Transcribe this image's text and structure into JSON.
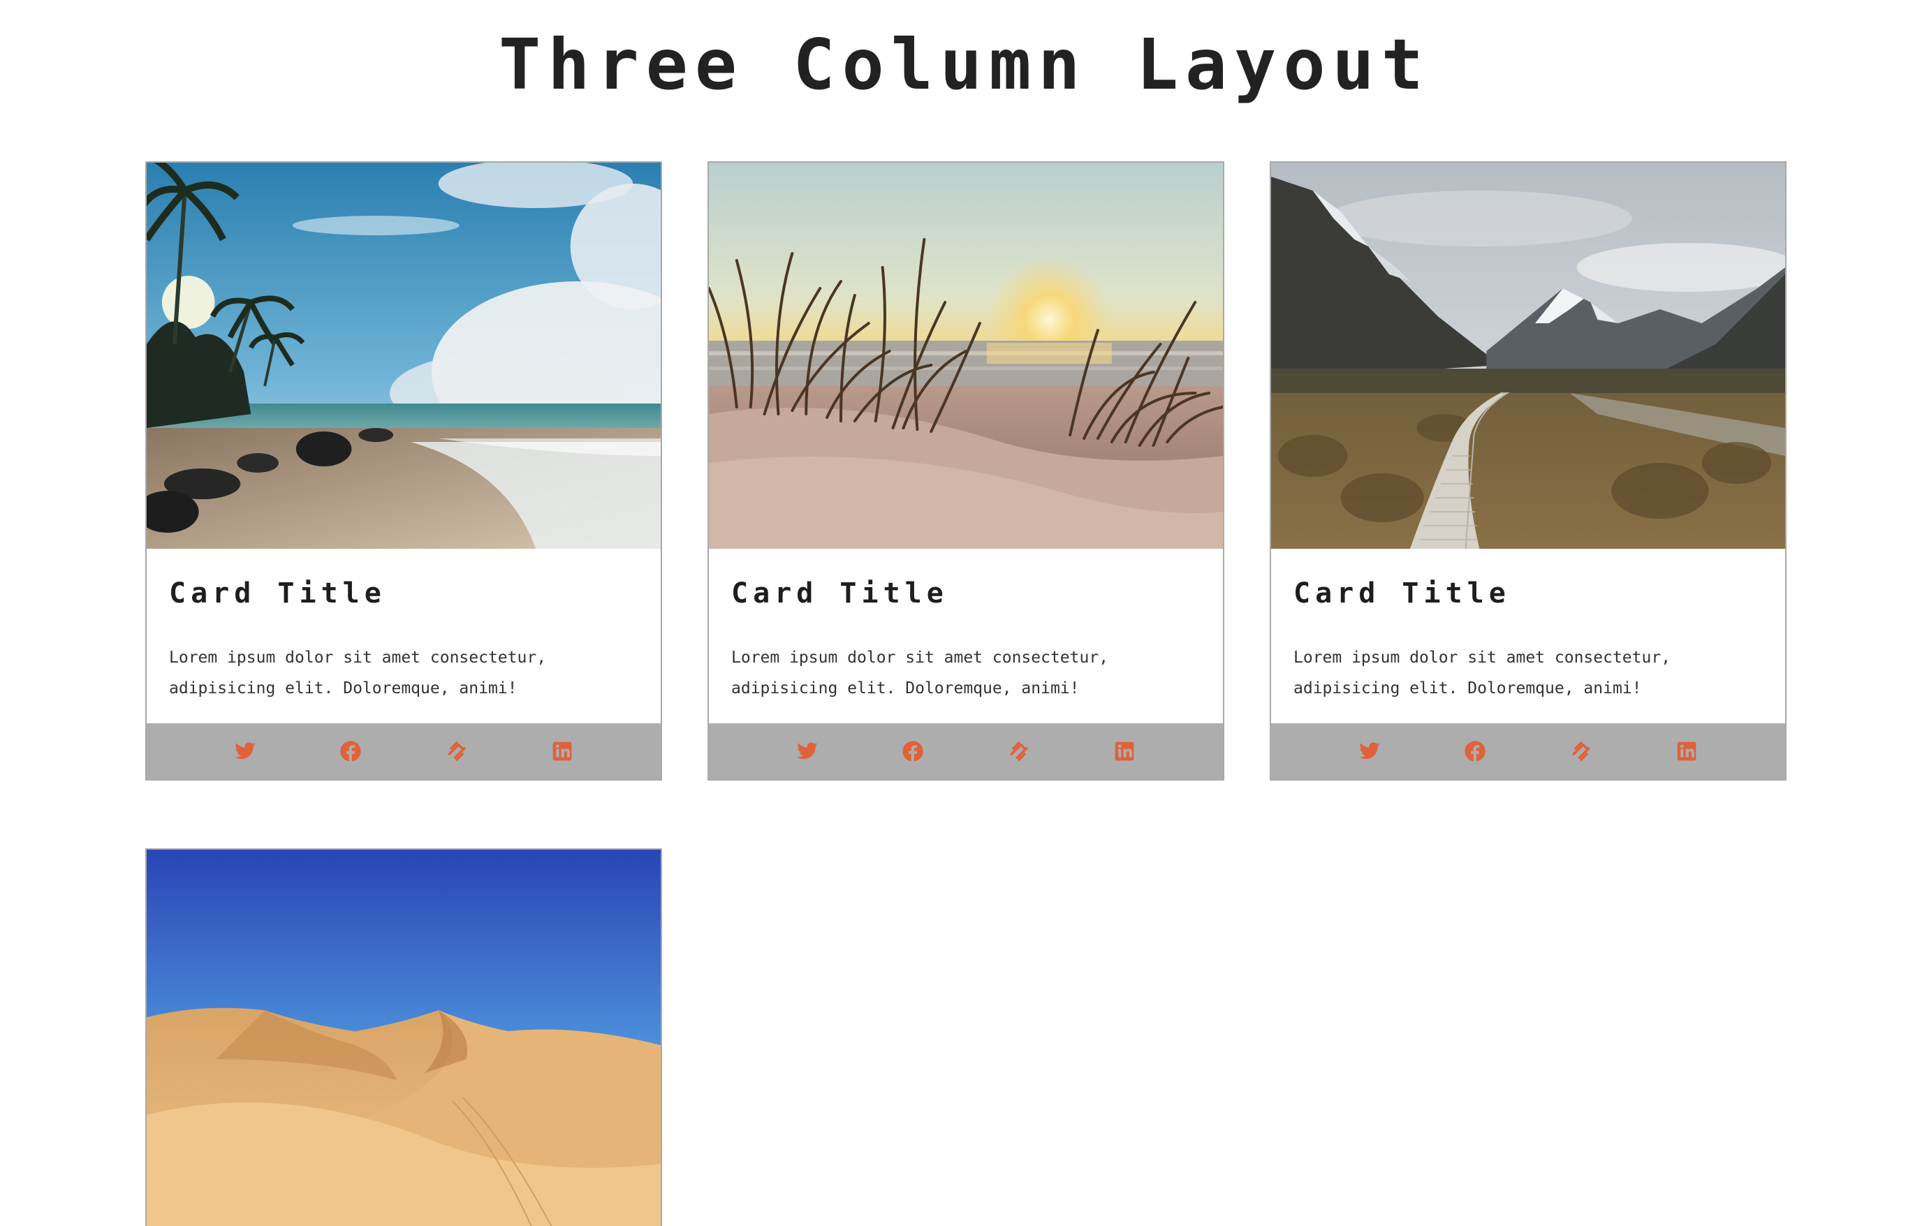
{
  "page": {
    "title": "Three Column Layout"
  },
  "colors": {
    "accent": "#e0613a",
    "footer_bg": "#adadad",
    "card_border": "#a9a9a9",
    "title_text": "#222222"
  },
  "cards": [
    {
      "image": "tropical-beach-photo",
      "title": "Card Title",
      "text": "Lorem ipsum dolor sit amet consectetur, adipisicing elit. Doloremque, animi!",
      "icons": [
        "twitter-icon",
        "facebook-icon",
        "squarespace-icon",
        "linkedin-icon"
      ]
    },
    {
      "image": "beach-sunset-grass-photo",
      "title": "Card Title",
      "text": "Lorem ipsum dolor sit amet consectetur, adipisicing elit. Doloremque, animi!",
      "icons": [
        "twitter-icon",
        "facebook-icon",
        "squarespace-icon",
        "linkedin-icon"
      ]
    },
    {
      "image": "mountain-boardwalk-photo",
      "title": "Card Title",
      "text": "Lorem ipsum dolor sit amet consectetur, adipisicing elit. Doloremque, animi!",
      "icons": [
        "twitter-icon",
        "facebook-icon",
        "squarespace-icon",
        "linkedin-icon"
      ]
    },
    {
      "image": "desert-dunes-photo"
    }
  ]
}
